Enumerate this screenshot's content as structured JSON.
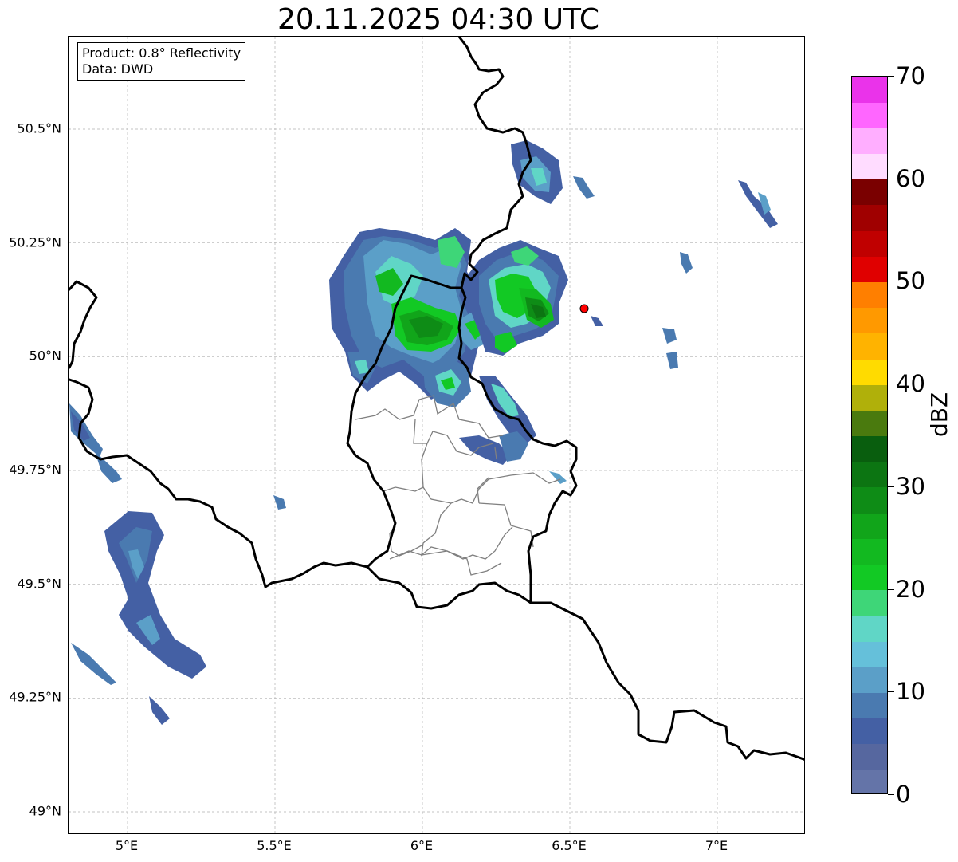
{
  "title": "20.11.2025 04:30 UTC",
  "info_box": {
    "line1": "Product: 0.8° Reflectivity",
    "line2": "Data: DWD"
  },
  "lat_ticks": [
    {
      "label": "50.5°N",
      "value": 50.5
    },
    {
      "label": "50.25°N",
      "value": 50.25
    },
    {
      "label": "50°N",
      "value": 50.0
    },
    {
      "label": "49.75°N",
      "value": 49.75
    },
    {
      "label": "49.5°N",
      "value": 49.5
    },
    {
      "label": "49.25°N",
      "value": 49.25
    },
    {
      "label": "49°N",
      "value": 49.0
    }
  ],
  "lon_ticks": [
    {
      "label": "5°E",
      "value": 5.0
    },
    {
      "label": "5.5°E",
      "value": 5.5
    },
    {
      "label": "6°E",
      "value": 6.0
    },
    {
      "label": "6.5°E",
      "value": 6.5
    },
    {
      "label": "7°E",
      "value": 7.0
    }
  ],
  "extent": {
    "lon_min": 4.8,
    "lon_max": 7.3,
    "lat_min": 48.95,
    "lat_max": 50.7
  },
  "colorbar": {
    "label": "dBZ",
    "min": 0,
    "max": 70,
    "tick_labels": [
      "0",
      "10",
      "20",
      "30",
      "40",
      "50",
      "60",
      "70"
    ],
    "colors": [
      "#6474a8",
      "#56679f",
      "#4460a4",
      "#4a7ab0",
      "#5b9fc8",
      "#65c0da",
      "#60d6c6",
      "#3ed678",
      "#12c924",
      "#12b920",
      "#11a51a",
      "#0e8c16",
      "#0c7512",
      "#095e0e",
      "#4a7a0e",
      "#b0b00a",
      "#ffdb00",
      "#ffb300",
      "#ff9900",
      "#ff7f00",
      "#e00000",
      "#c00000",
      "#a00000",
      "#7a0000",
      "#ffdcff",
      "#ffaeff",
      "#ff66ff",
      "#ea33ea"
    ]
  },
  "radar_station": {
    "lat": 50.11,
    "lon": 6.548,
    "color": "#ff0000"
  },
  "colors": {
    "border": "#000000",
    "admin_border": "#808080",
    "grid": "#b0b0b0"
  }
}
